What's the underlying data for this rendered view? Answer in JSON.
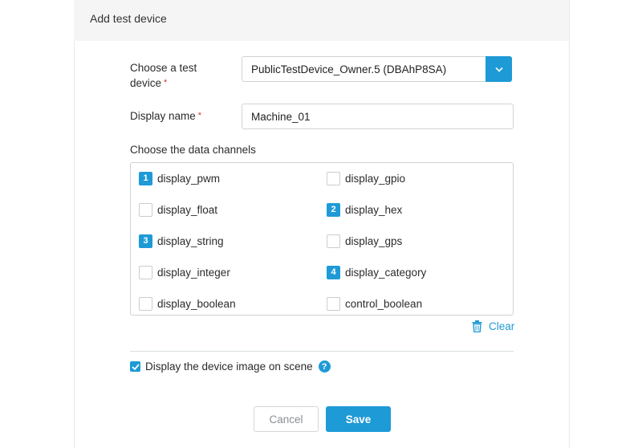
{
  "dialog": {
    "title": "Add test device",
    "device_label": "Choose a test device",
    "device_label_line1": "Choose a test",
    "device_label_line2": "device",
    "required_mark": "*",
    "device_value": "PublicTestDevice_Owner.5 (DBAhP8SA)",
    "display_name_label": "Display name",
    "display_name_value": "Machine_01",
    "channels_label": "Choose the data channels",
    "channels": [
      {
        "label": "display_pwm",
        "order": "1"
      },
      {
        "label": "display_gpio",
        "order": ""
      },
      {
        "label": "display_float",
        "order": ""
      },
      {
        "label": "display_hex",
        "order": "2"
      },
      {
        "label": "display_string",
        "order": "3"
      },
      {
        "label": "display_gps",
        "order": ""
      },
      {
        "label": "display_integer",
        "order": ""
      },
      {
        "label": "display_category",
        "order": "4"
      },
      {
        "label": "display_boolean",
        "order": ""
      },
      {
        "label": "control_boolean",
        "order": ""
      }
    ],
    "clear_label": "Clear",
    "show_image_label": "Display the device image on scene",
    "show_image_checked": true,
    "help_glyph": "?",
    "cancel_label": "Cancel",
    "save_label": "Save"
  },
  "colors": {
    "accent": "#1e9ad6",
    "required": "#d9342b",
    "header_bg": "#f5f5f5"
  },
  "icons": {
    "dropdown": "chevron-down-icon",
    "clear": "trash-icon",
    "help": "help-icon",
    "checkbox": "check-icon"
  }
}
